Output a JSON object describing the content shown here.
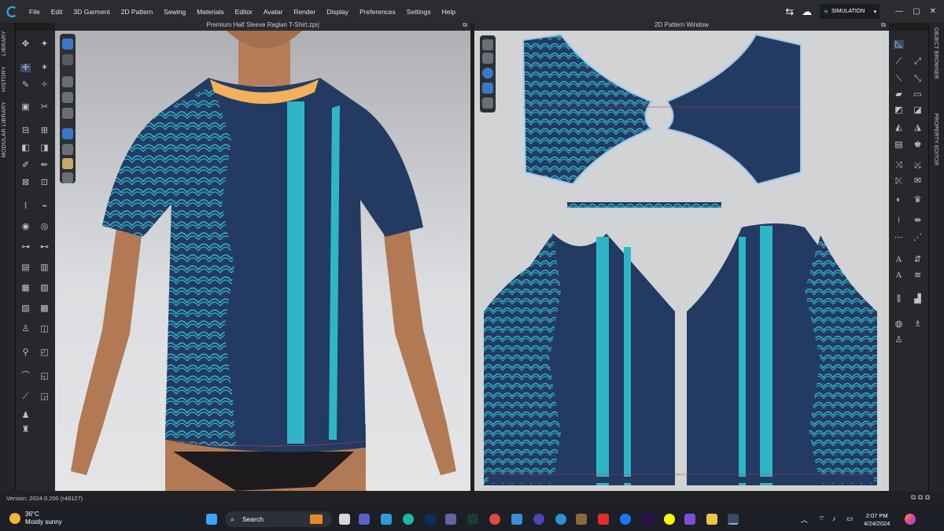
{
  "menubar": {
    "items": [
      "File",
      "Edit",
      "3D Garment",
      "2D Pattern",
      "Sewing",
      "Materials",
      "Editor",
      "Avatar",
      "Render",
      "Display",
      "Preferences",
      "Settings",
      "Help"
    ],
    "mode_label": "SIMULATION"
  },
  "left_tabs": {
    "library": "LIBRARY",
    "history": "HISTORY",
    "modular": "MODULAR LIBRARY"
  },
  "right_tabs": {
    "object_browser": "OBJECT BROWSER",
    "property_editor": "PROPERTY EDITOR"
  },
  "view3d": {
    "title": "Premium Half Sleeve Raglan T-Shirt.zprj"
  },
  "view2d": {
    "title": "2D Pattern Window"
  },
  "statusbar": {
    "version": "Version: 2024.0.200 (r48127)"
  },
  "taskbar": {
    "temperature": "36°C",
    "weather_desc": "Mostly sunny",
    "search_label": "Search",
    "time": "2:07 PM",
    "date": "4/24/2024"
  },
  "colors": {
    "navy": "#233a63",
    "teal": "#2fb6c6",
    "collar": "#f2b25b",
    "skin": "#b17a55"
  }
}
